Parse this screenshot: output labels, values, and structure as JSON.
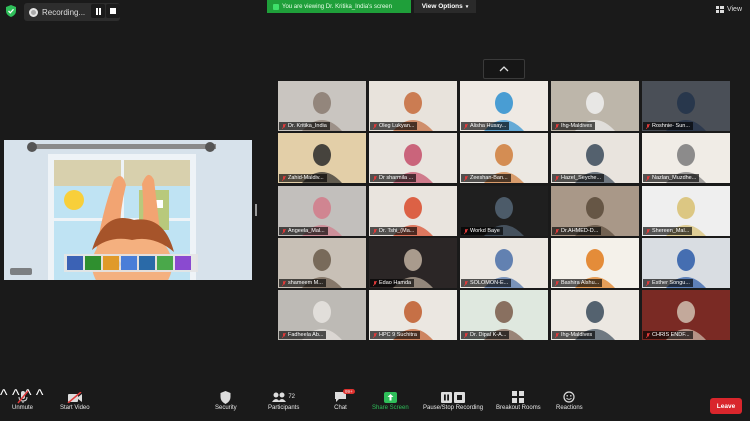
{
  "topbar": {
    "recording_label": "Recording...",
    "banner_text": "You are viewing Dr. Kritika_India's screen",
    "view_options_label": "View Options",
    "view_label": "View"
  },
  "colors": {
    "accent_green": "#1f9f3a",
    "leave_red": "#d9262c",
    "toolbar_bg": "#1a1a1a"
  },
  "participants": [
    "Dr. Kritika_India",
    "Oleg Lukyan...",
    "Alisha Husay...",
    "Ihg-Maldives",
    "Roshnie- Sun...",
    "Zahid-Maldiv...",
    "Dr sharmila ...",
    "Zeeshan-Ban...",
    "Hazel_Seyche...",
    "Nazlan_Muzdhe...",
    "Angeela_Mal...",
    "Dr. Tshi_(Ma...",
    "Workd Baye",
    "Dr.AHMED-D...",
    "Shereen_Mal...",
    "shameem M...",
    "Edao Hamda",
    "SOLOMON-E...",
    "Bashira Alshu...",
    "Esther Songu...",
    "Fadheela Ab...",
    "HPC 9 Suchitra",
    "Dr. Dipal K-A...",
    "Ihg-Maldives",
    "CHRIS ENDF..."
  ],
  "toolbar": {
    "unmute": "Unmute",
    "start_video": "Start Video",
    "security": "Security",
    "participants": "Participants",
    "participant_count": "72",
    "chat": "Chat",
    "chat_badge": "99+",
    "share_screen": "Share Screen",
    "pause_recording": "Pause/Stop Recording",
    "breakout_rooms": "Breakout Rooms",
    "reactions": "Reactions",
    "leave": "Leave"
  }
}
